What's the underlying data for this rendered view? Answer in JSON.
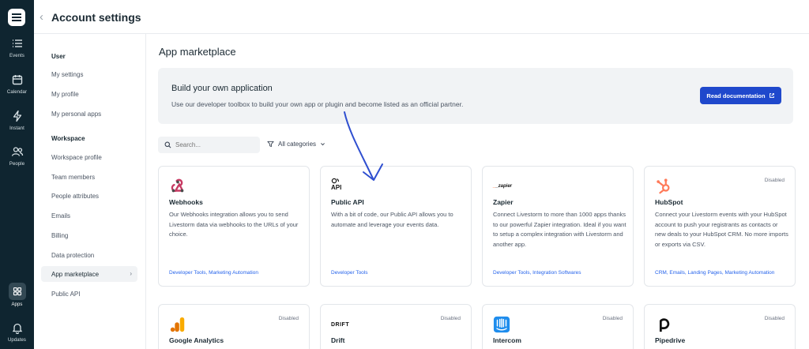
{
  "rail": {
    "items": [
      {
        "label": "Events",
        "icon": "list-icon"
      },
      {
        "label": "Calendar",
        "icon": "calendar-icon"
      },
      {
        "label": "Instant",
        "icon": "lightning-icon"
      },
      {
        "label": "People",
        "icon": "people-icon"
      },
      {
        "label": "Apps",
        "icon": "grid-icon"
      },
      {
        "label": "Updates",
        "icon": "bell-icon"
      }
    ]
  },
  "header": {
    "title": "Account settings"
  },
  "sidebar": {
    "group_user": "User",
    "user_items": [
      "My settings",
      "My profile",
      "My personal apps"
    ],
    "group_workspace": "Workspace",
    "workspace_items": [
      "Workspace profile",
      "Team members",
      "People attributes",
      "Emails",
      "Billing",
      "Data protection",
      "App marketplace",
      "Public API"
    ]
  },
  "main": {
    "title": "App marketplace",
    "banner": {
      "title": "Build your own application",
      "subtitle": "Use our developer toolbox to build your own app or plugin and become listed as an official partner.",
      "button": "Read documentation"
    },
    "search_placeholder": "Search...",
    "filter": "All categories"
  },
  "cards": [
    {
      "name": "Webhooks",
      "desc": "Our Webhooks integration allows you to send Livestorm data via webhooks to the URLs of your choice.",
      "tags": "Developer Tools, Marketing Automation",
      "status": "",
      "icon": "webhooks-icon"
    },
    {
      "name": "Public API",
      "desc": "With a bit of code, our Public API allows you to automate and leverage your events data.",
      "tags": "Developer Tools",
      "status": "",
      "icon": "api-icon"
    },
    {
      "name": "Zapier",
      "desc": "Connect Livestorm to more than 1000 apps thanks to our powerful Zapier integration. Ideal if you want to setup a complex integration with Livestorm and another app.",
      "tags": "Developer Tools, Integration Softwares",
      "status": "",
      "icon": "zapier-logo"
    },
    {
      "name": "HubSpot",
      "desc": "Connect your Livestorm events with your HubSpot account to push your registrants as contacts or new deals to your HubSpot CRM. No more imports or exports via CSV.",
      "tags": "CRM, Emails, Landing Pages, Marketing Automation",
      "status": "Disabled",
      "icon": "hubspot-icon"
    },
    {
      "name": "Google Analytics",
      "desc": "",
      "tags": "",
      "status": "Disabled",
      "icon": "google-analytics-icon"
    },
    {
      "name": "Drift",
      "desc": "",
      "tags": "",
      "status": "Disabled",
      "icon": "drift-logo"
    },
    {
      "name": "Intercom",
      "desc": "",
      "tags": "",
      "status": "Disabled",
      "icon": "intercom-icon"
    },
    {
      "name": "Pipedrive",
      "desc": "",
      "tags": "",
      "status": "Disabled",
      "icon": "pipedrive-icon"
    }
  ],
  "logos": {
    "zapier": "_zapier",
    "drift": "DRIFT",
    "api": "API"
  },
  "colors": {
    "rail": "#0f2530",
    "primary": "#1f48cc",
    "link": "#2563eb",
    "hubspot": "#ff7a59",
    "google_analytics": "#f9ab00",
    "intercom": "#1f8ded",
    "arrow": "#2f4fd0"
  }
}
